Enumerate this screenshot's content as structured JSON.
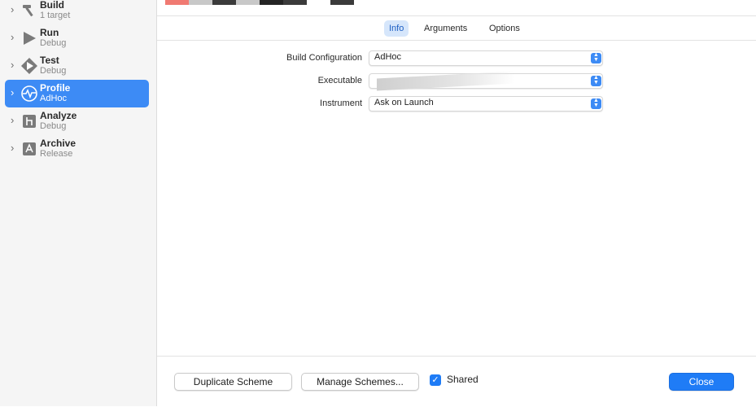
{
  "schemes": [
    {
      "title": "Build",
      "subtitle": "1 target",
      "icon": "hammer-icon"
    },
    {
      "title": "Run",
      "subtitle": "Debug",
      "icon": "play-icon"
    },
    {
      "title": "Test",
      "subtitle": "Debug",
      "icon": "diamond-play-icon"
    },
    {
      "title": "Profile",
      "subtitle": "AdHoc",
      "icon": "waveform-icon"
    },
    {
      "title": "Analyze",
      "subtitle": "Debug",
      "icon": "analyze-icon"
    },
    {
      "title": "Archive",
      "subtitle": "Release",
      "icon": "archive-icon"
    }
  ],
  "selected_scheme": "Profile",
  "tabs": [
    {
      "label": "Info",
      "active": true
    },
    {
      "label": "Arguments",
      "active": false
    },
    {
      "label": "Options",
      "active": false
    }
  ],
  "form": {
    "build_configuration": {
      "label": "Build Configuration",
      "value": "AdHoc"
    },
    "executable": {
      "label": "Executable",
      "value": ""
    },
    "instrument": {
      "label": "Instrument",
      "value": "Ask on Launch"
    }
  },
  "footer": {
    "duplicate": "Duplicate Scheme",
    "manage": "Manage Schemes...",
    "shared_label": "Shared",
    "shared_checked": true,
    "close": "Close"
  },
  "colors": {
    "accent": "#3d8bf5",
    "primary_button": "#1f7cf6",
    "strip": [
      "#f07a72",
      "#c8c8c8",
      "#3b3b3b",
      "#c8c8c8",
      "#242424",
      "#3b3b3b",
      "#3b3b3b"
    ]
  }
}
